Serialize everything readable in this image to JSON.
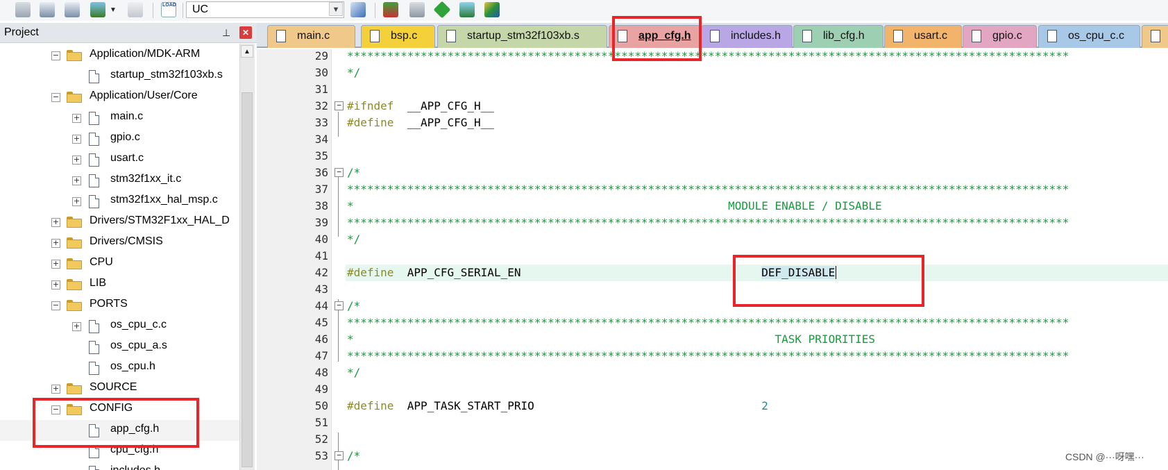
{
  "toolbar": {
    "target": "UC",
    "icons": [
      "batch-build-icon",
      "build-icon",
      "rebuild-icon",
      "options-icon",
      "download-icon",
      "load-icon",
      "manage-components-icon",
      "pack-installer-icon",
      "select-software-packs-icon",
      "event-recorder-icon",
      "configure-icon"
    ],
    "load_label": "LOAD"
  },
  "project_panel": {
    "title": "Project",
    "tree": [
      {
        "label": "Application/MDK-ARM",
        "type": "folder",
        "expanded": true,
        "level": 0
      },
      {
        "label": "startup_stm32f103xb.s",
        "type": "file",
        "level": 1
      },
      {
        "label": "Application/User/Core",
        "type": "folder",
        "expanded": true,
        "level": 0
      },
      {
        "label": "main.c",
        "type": "file",
        "level": 1,
        "expandable": true
      },
      {
        "label": "gpio.c",
        "type": "file",
        "level": 1,
        "expandable": true
      },
      {
        "label": "usart.c",
        "type": "file",
        "level": 1,
        "expandable": true
      },
      {
        "label": "stm32f1xx_it.c",
        "type": "file",
        "level": 1,
        "expandable": true
      },
      {
        "label": "stm32f1xx_hal_msp.c",
        "type": "file",
        "level": 1,
        "expandable": true
      },
      {
        "label": "Drivers/STM32F1xx_HAL_D",
        "type": "folder",
        "expanded": false,
        "level": 0
      },
      {
        "label": "Drivers/CMSIS",
        "type": "folder",
        "expanded": false,
        "level": 0
      },
      {
        "label": "CPU",
        "type": "folder",
        "expanded": false,
        "level": 0
      },
      {
        "label": "LIB",
        "type": "folder",
        "expanded": false,
        "level": 0
      },
      {
        "label": "PORTS",
        "type": "folder",
        "expanded": true,
        "level": 0
      },
      {
        "label": "os_cpu_c.c",
        "type": "file",
        "level": 1,
        "expandable": true
      },
      {
        "label": "os_cpu_a.s",
        "type": "file",
        "level": 1
      },
      {
        "label": "os_cpu.h",
        "type": "file",
        "level": 1
      },
      {
        "label": "SOURCE",
        "type": "folder",
        "expanded": false,
        "level": 0
      },
      {
        "label": "CONFIG",
        "type": "folder",
        "expanded": true,
        "level": 0
      },
      {
        "label": "app_cfg.h",
        "type": "file",
        "level": 1,
        "selected": true
      },
      {
        "label": "cpu_cfg.h",
        "type": "file",
        "level": 1
      },
      {
        "label": "includes.h",
        "type": "file",
        "level": 1
      }
    ]
  },
  "tabs": [
    {
      "label": "main.c",
      "color": "#f0c98a"
    },
    {
      "label": "bsp.c",
      "color": "#f4d13a"
    },
    {
      "label": "startup_stm32f103xb.s",
      "color": "#c5d6a8"
    },
    {
      "label": "app_cfg.h",
      "color": "#eaa3a3",
      "active": true
    },
    {
      "label": "includes.h",
      "color": "#b9a6e4"
    },
    {
      "label": "lib_cfg.h",
      "color": "#9dcfb3"
    },
    {
      "label": "usart.c",
      "color": "#f2b36b"
    },
    {
      "label": "gpio.c",
      "color": "#e2a6c2"
    },
    {
      "label": "os_cpu_c.c",
      "color": "#a8c8e8"
    },
    {
      "label": "",
      "color": "#f0c98a"
    }
  ],
  "editor": {
    "lines": [
      {
        "n": "29",
        "text": "************************************************************************************************************",
        "kind": "comment"
      },
      {
        "n": "30",
        "text": "*/",
        "kind": "comment"
      },
      {
        "n": "31",
        "text": "",
        "kind": "plain"
      },
      {
        "n": "32",
        "kw": "#ifndef",
        "rest": "  __APP_CFG_H__",
        "kind": "directive",
        "fold": true
      },
      {
        "n": "33",
        "kw": "#define",
        "rest": "  __APP_CFG_H__",
        "kind": "directive"
      },
      {
        "n": "34",
        "text": "",
        "kind": "plain"
      },
      {
        "n": "35",
        "text": "",
        "kind": "plain"
      },
      {
        "n": "36",
        "text": "/*",
        "kind": "comment",
        "fold": true
      },
      {
        "n": "37",
        "text": "************************************************************************************************************",
        "kind": "comment"
      },
      {
        "n": "38",
        "text": "*                                                        MODULE ENABLE / DISABLE",
        "kind": "comment"
      },
      {
        "n": "39",
        "text": "************************************************************************************************************",
        "kind": "comment"
      },
      {
        "n": "40",
        "text": "*/",
        "kind": "comment"
      },
      {
        "n": "41",
        "text": "",
        "kind": "plain"
      },
      {
        "n": "42",
        "kw": "#define",
        "rest": "  APP_CFG_SERIAL_EN                    ",
        "value": "DEF_DISABLE",
        "kind": "define-sel",
        "highlight": true
      },
      {
        "n": "43",
        "text": "",
        "kind": "plain"
      },
      {
        "n": "44",
        "text": "/*",
        "kind": "comment",
        "fold": true
      },
      {
        "n": "45",
        "text": "************************************************************************************************************",
        "kind": "comment"
      },
      {
        "n": "46",
        "text": "*                                                               TASK PRIORITIES",
        "kind": "comment"
      },
      {
        "n": "47",
        "text": "************************************************************************************************************",
        "kind": "comment"
      },
      {
        "n": "48",
        "text": "*/",
        "kind": "comment"
      },
      {
        "n": "49",
        "text": "",
        "kind": "plain"
      },
      {
        "n": "50",
        "kw": "#define",
        "rest": "  APP_TASK_START_PRIO                  ",
        "value": "2",
        "kind": "define-num"
      },
      {
        "n": "51",
        "text": "",
        "kind": "plain"
      },
      {
        "n": "52",
        "text": "",
        "kind": "plain"
      },
      {
        "n": "53",
        "text": "/*",
        "kind": "comment",
        "fold": true
      }
    ]
  },
  "watermark": "CSDN @···呀嘿···"
}
